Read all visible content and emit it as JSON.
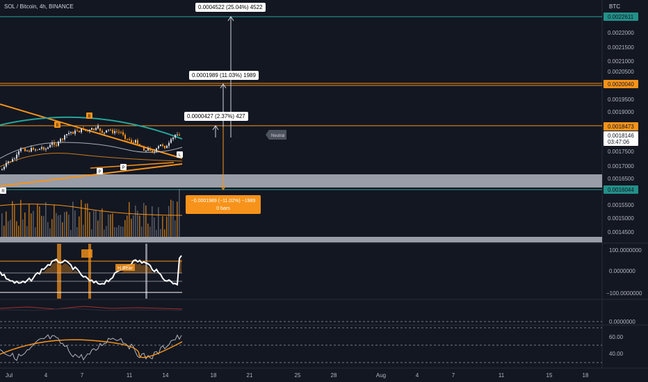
{
  "header": {
    "symbol": "SOL / Bitcoin, 4h, BINANCE",
    "currency": "BTC"
  },
  "price_axis": {
    "labels": [
      "0.0022000",
      "0.0021500",
      "0.0021000",
      "0.0020500",
      "0.0019500",
      "0.0019000",
      "0.0017500",
      "0.0017000",
      "0.0016500",
      "0.0015500",
      "0.0015000",
      "0.0014500"
    ],
    "tags": {
      "top": "0.0022611",
      "upper": "0.0020040",
      "mid": "0.0018473",
      "current": "0.0018146",
      "countdown": "03:47:06",
      "low": "0.0016044"
    }
  },
  "measure_labels": {
    "up_large": "0.0004522 (25.04%) 4522",
    "up_mid": "0.0001989 (11.03%) 1989",
    "up_small": "0.0000427 (2.37%) 427",
    "down_line1": "−0.0001989 (−11.02%) −1989",
    "down_line2": "0 bars"
  },
  "annotations": {
    "neutral": "Neutral",
    "h_bear": "H Bear",
    "marker_b": "B",
    "marker_p": "P",
    "marker_r": "R",
    "marker_l": "L"
  },
  "oscillator_1": {
    "labels": [
      "100.0000000",
      "0.0000000",
      "−100.0000000"
    ]
  },
  "oscillator_2": {
    "labels": [
      "0.0000000"
    ]
  },
  "rsi": {
    "labels": [
      "60.00",
      "40.00"
    ]
  },
  "time_axis": [
    "Jul",
    "4",
    "7",
    "11",
    "14",
    "18",
    "21",
    "25",
    "28",
    "Aug",
    "4",
    "7",
    "11",
    "15",
    "18"
  ],
  "colors": {
    "background": "#131722",
    "orange": "#f7931a",
    "teal": "#26a69a",
    "white": "#d1d4dc",
    "gray_band": "#b2b5be"
  }
}
